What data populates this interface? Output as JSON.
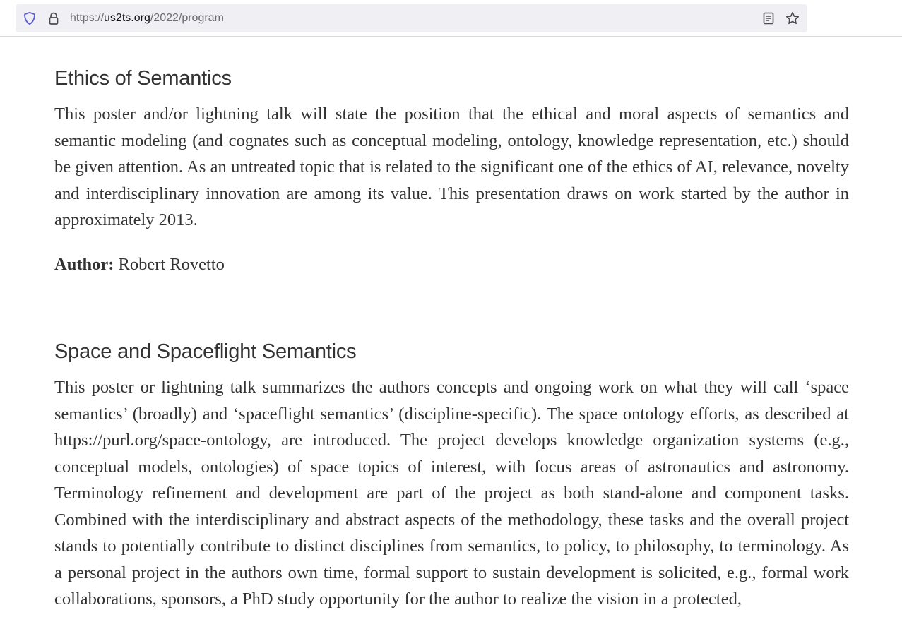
{
  "browser": {
    "url_scheme": "https://",
    "url_host": "us2ts.org",
    "url_path": "/2022/program"
  },
  "sections": [
    {
      "title": "Ethics of Semantics",
      "body": "This poster and/or lightning talk will state the position that the ethical and moral aspects of semantics and semantic modeling (and cognates such as conceptual modeling, ontology, knowledge representation, etc.) should be given attention. As an untreated topic that is related to the significant one of the ethics of AI, relevance, novelty and interdisciplinary innovation are among its value. This presentation draws on work started by the author in approximately 2013.",
      "author_label": "Author:",
      "author_name": "Robert Rovetto"
    },
    {
      "title": "Space and Spaceflight Semantics",
      "body": "This poster or lightning talk summarizes the authors concepts and ongoing work on what they will call ‘space semantics’ (broadly) and ‘spaceflight semantics’ (discipline-specific). The space ontology efforts, as described at https://purl.org/space-ontology, are introduced. The project develops knowledge organization systems (e.g., conceptual models, ontologies) of space topics of interest, with focus areas of astronautics and astronomy. Terminology refinement and development are part of the project as both stand-alone and component tasks. Combined with the interdisciplinary and abstract aspects of the methodology, these tasks and the overall project stands to potentially contribute to distinct disciplines from semantics, to policy, to philosophy, to terminology. As a personal project in the authors own time, formal support to sustain development is solicited, e.g., formal work collaborations, sponsors, a PhD study opportunity for the author to realize the vision in a protected,"
    }
  ]
}
